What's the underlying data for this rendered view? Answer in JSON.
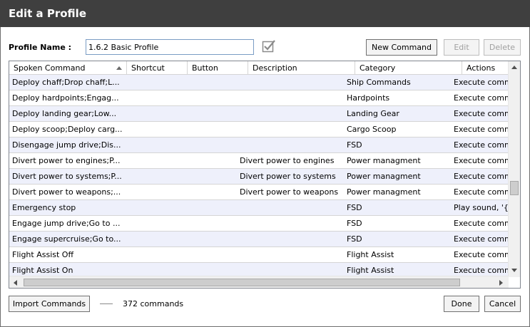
{
  "window": {
    "title": "Edit a Profile"
  },
  "profile": {
    "label": "Profile Name :",
    "value": "1.6.2 Basic Profile"
  },
  "buttons": {
    "new_command": "New Command",
    "edit": "Edit",
    "delete": "Delete",
    "import": "Import Commands",
    "done": "Done",
    "cancel": "Cancel"
  },
  "table": {
    "columns": [
      "Spoken Command",
      "Shortcut",
      "Button",
      "Description",
      "Category",
      "Actions"
    ],
    "rows": [
      [
        "Deploy chaff;Drop chaff;L...",
        "",
        "",
        "",
        "Ship Commands",
        "Execute comma"
      ],
      [
        "Deploy hardpoints;Engag...",
        "",
        "",
        "",
        "Hardpoints",
        "Execute comma"
      ],
      [
        "Deploy landing gear;Low...",
        "",
        "",
        "",
        "Landing Gear",
        "Execute comma"
      ],
      [
        "Deploy scoop;Deploy carg...",
        "",
        "",
        "",
        "Cargo Scoop",
        "Execute comma"
      ],
      [
        "Disengage jump drive;Dis...",
        "",
        "",
        "",
        "FSD",
        "Execute comma"
      ],
      [
        "Divert power to engines;P...",
        "",
        "",
        "Divert power to engines",
        "Power managment",
        "Execute comma"
      ],
      [
        "Divert power to systems;P...",
        "",
        "",
        "Divert power to systems",
        "Power managment",
        "Execute comma"
      ],
      [
        "Divert power to weapons;...",
        "",
        "",
        "Divert power to weapons",
        "Power managment",
        "Execute comma"
      ],
      [
        "Emergency stop",
        "",
        "",
        "",
        "FSD",
        "Play sound, '{V..."
      ],
      [
        "Engage jump drive;Go to ...",
        "",
        "",
        "",
        "FSD",
        "Execute comma"
      ],
      [
        "Engage supercruise;Go to...",
        "",
        "",
        "",
        "FSD",
        "Execute comma"
      ],
      [
        "Flight Assist Off",
        "",
        "",
        "",
        "Flight Assist",
        "Execute comma"
      ],
      [
        "Flight Assist On",
        "",
        "",
        "",
        "Flight Assist",
        "Execute comma"
      ]
    ]
  },
  "status": {
    "count": "372 commands"
  },
  "icons": {
    "check": "checkbox-check-icon",
    "sort": "sort-ascending-icon"
  },
  "colors": {
    "titlebar": "#3f3f3f",
    "row_alt": "#eef0fb",
    "input_border": "#7a9cc4"
  }
}
